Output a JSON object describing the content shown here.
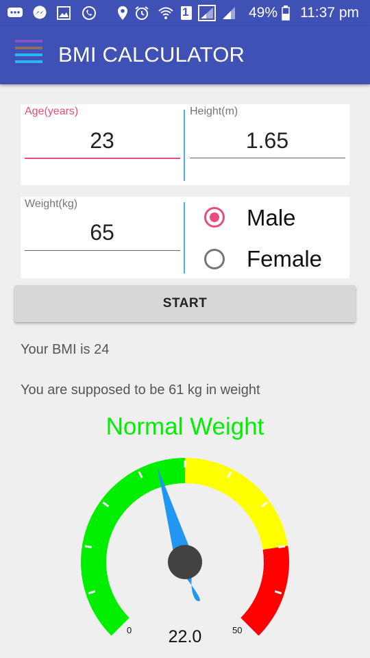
{
  "status_bar": {
    "battery": "49%",
    "time": "11:37 pm",
    "sim": "1"
  },
  "app_bar": {
    "title": "BMI CALCULATOR"
  },
  "form": {
    "age_label": "Age(years)",
    "age_value": "23",
    "height_label": "Height(m)",
    "height_value": "1.65",
    "weight_label": "Weight(kg)",
    "weight_value": "65",
    "gender_options": [
      "Male",
      "Female"
    ],
    "gender_selected": "Male",
    "start_label": "START"
  },
  "result": {
    "bmi_text": "Your BMI is 24",
    "ideal_text": "You are supposed to be 61 kg in weight",
    "category": "Normal Weight",
    "category_color": "#00ee00"
  },
  "gauge": {
    "min_label": "0",
    "max_label": "50",
    "value_label": "22.0",
    "min": 0,
    "max": 50,
    "value": 22.0,
    "ranges": [
      {
        "from": 0,
        "to": 25,
        "color": "#00ee00"
      },
      {
        "from": 25,
        "to": 40,
        "color": "#ffff00"
      },
      {
        "from": 40,
        "to": 50,
        "color": "#ff0000"
      }
    ],
    "needle_color": "#2196f3",
    "hub_color": "#424242"
  },
  "colors": {
    "primary": "#3f51b5",
    "accent": "#e84c7d",
    "divider": "#4fb3d9"
  },
  "icons": [
    "sms-icon",
    "messenger-icon",
    "gallery-icon",
    "whatsapp-icon",
    "location-icon",
    "alarm-icon",
    "wifi-icon",
    "sim-icon",
    "signal-icon",
    "signal-icon-2",
    "battery-icon",
    "menu-icon"
  ]
}
